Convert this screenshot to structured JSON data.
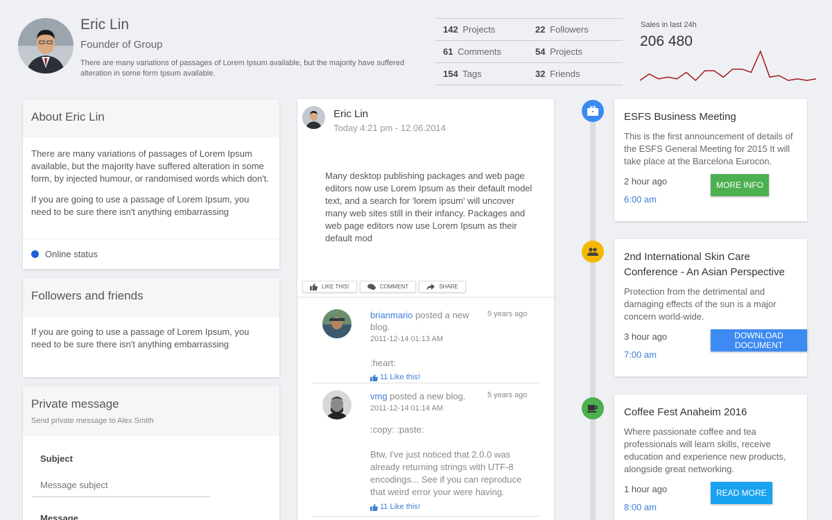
{
  "profile": {
    "name": "Eric Lin",
    "role": "Founder of Group",
    "description": "There are many variations of passages of Lorem Ipsum available, but the majority have suffered alteration in some form Ipsum available."
  },
  "stats": [
    {
      "value": "142",
      "label": "Projects"
    },
    {
      "value": "22",
      "label": "Followers"
    },
    {
      "value": "61",
      "label": "Comments"
    },
    {
      "value": "54",
      "label": "Projects"
    },
    {
      "value": "154",
      "label": "Tags"
    },
    {
      "value": "32",
      "label": "Friends"
    }
  ],
  "sales": {
    "label": "Sales in last 24h",
    "value": "206 480",
    "color": "#a3161a",
    "sparkline": [
      2,
      6,
      3,
      4,
      3,
      7,
      2,
      8,
      8,
      4,
      9,
      9,
      7,
      20,
      4,
      5,
      2,
      3,
      2,
      3
    ]
  },
  "about": {
    "title": "About Eric Lin",
    "p1": "There are many variations of passages of Lorem Ipsum available, but the majority have suffered alteration in some form, by injected humour, or randomised words which don't.",
    "p2": "If you are going to use a passage of Lorem Ipsum, you need to be sure there isn't anything embarrassing",
    "status": "Online status",
    "status_color": "#1e5fd6"
  },
  "followers": {
    "title": "Followers and friends",
    "text": "If you are going to use a passage of Lorem Ipsum, you need to be sure there isn't anything embarrassing"
  },
  "private_message": {
    "title": "Private message",
    "subtitle": "Send private message to Alex Smith",
    "subject_label": "Subject",
    "subject_placeholder": "Message subject",
    "message_label": "Message"
  },
  "post": {
    "author": "Eric Lin",
    "date": "Today 4:21 pm - 12.06.2014",
    "text": "Many desktop publishing packages and web page editors now use Lorem Ipsum as their default model text, and a search for 'lorem ipsum' will uncover many web sites still in their infancy. Packages and web page editors now use Lorem Ipsum as their default mod",
    "actions": {
      "like": "Like this!",
      "comment": "Comment",
      "share": "Share"
    },
    "comments": [
      {
        "user": "brianmario",
        "action": " posted a new blog.",
        "ago": "5 years ago",
        "date": "2011-12-14 01:13 AM",
        "body": ":heart:",
        "likes": "11 Like this!"
      },
      {
        "user": "vmg",
        "action": " posted a new blog.",
        "ago": "5 years ago",
        "date": "2011-12-14 01:14 AM",
        "body1": ":copy: :paste:",
        "body2": "Btw, I've just noticed that 2.0.0 was already returning strings with UTF-8 encodings... See if you can reproduce that weird error your were having.",
        "likes": "11 Like this!"
      }
    ]
  },
  "timeline": [
    {
      "icon": "briefcase-icon",
      "color": "#3d8bf2",
      "title": "ESFS Business Meeting",
      "description": "This is the first announcement of details of the ESFS General Meeting for 2015 It will take place at the Barcelona Eurocon.",
      "ago": "2 hour ago",
      "time": "6:00 am",
      "button": "MORE INFO",
      "button_color": "#4caf50"
    },
    {
      "icon": "people-icon",
      "color": "#f5b800",
      "title": "2nd International Skin Care Conference - An Asian Perspective",
      "description": "Protection from the detrimental and damaging effects of the sun is a major concern world-wide.",
      "ago": "3 hour ago",
      "time": "7:00 am",
      "button": "DOWNLOAD DOCUMENT",
      "button_color": "#3d8bf2"
    },
    {
      "icon": "coffee-icon",
      "color": "#4caf50",
      "title": "Coffee Fest Anaheim 2016",
      "description": "Where passionate coffee and tea professionals will learn skills, receive education and experience new products, alongside great networking.",
      "ago": "1 hour ago",
      "time": "8:00 am",
      "button": "READ MORE",
      "button_color": "#1aa3f0"
    }
  ]
}
